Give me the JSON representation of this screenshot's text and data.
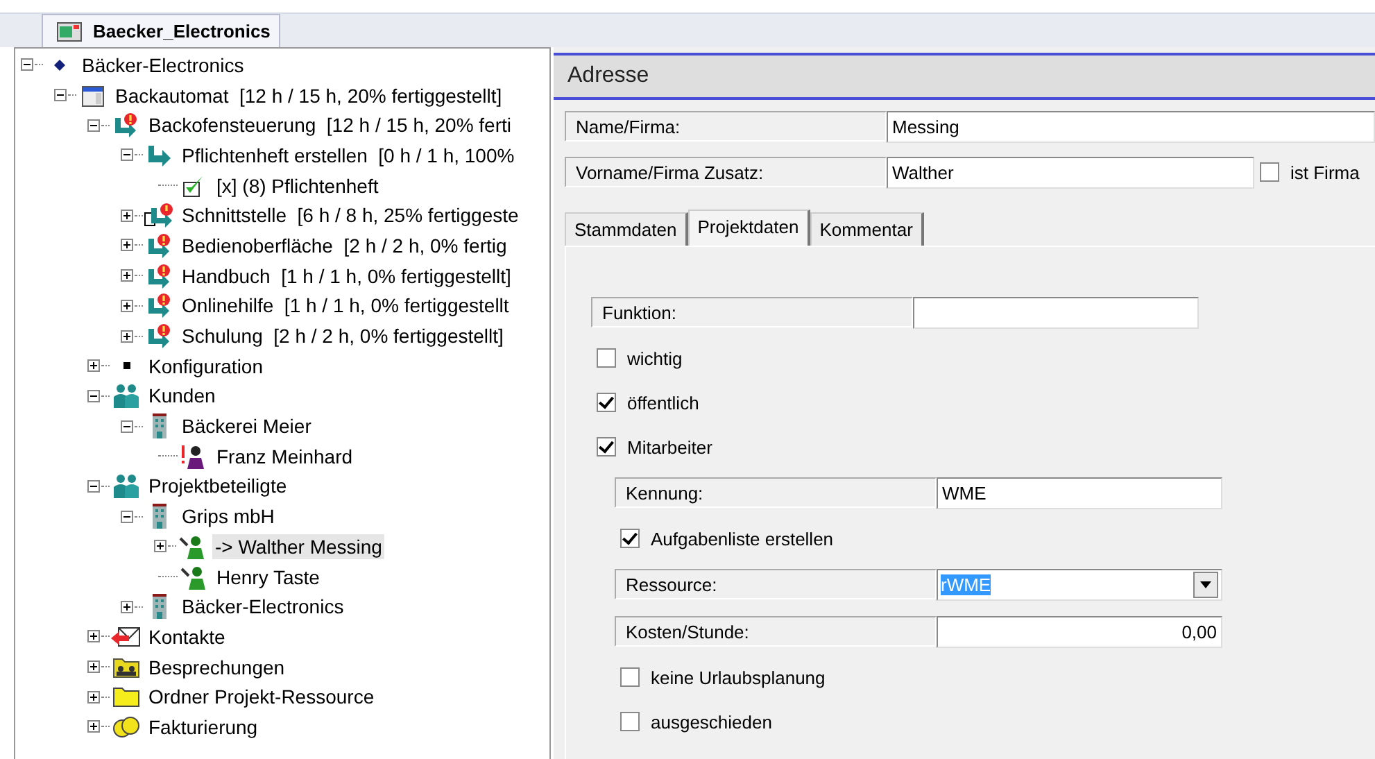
{
  "document_tab": {
    "label": "Baecker_Electronics",
    "selected": true
  },
  "tree": [
    {
      "label": "Bäcker-Electronics",
      "kind": "diamond",
      "expandable": true,
      "expanded": true,
      "selected": false,
      "children": [
        {
          "label": "Backautomat  [12 h / 15 h, 20% fertiggestellt]",
          "kind": "window",
          "expandable": true,
          "expanded": true,
          "selected": false,
          "children": [
            {
              "label": "Backofensteuerung  [12 h / 15 h, 20% ferti",
              "kind": "task-alert",
              "expandable": true,
              "expanded": true,
              "selected": false,
              "children": [
                {
                  "label": "Pflichtenheft erstellen  [0 h / 1 h, 100%",
                  "kind": "task",
                  "expandable": true,
                  "expanded": true,
                  "selected": false,
                  "children": [
                    {
                      "label": "[x] (8) Pflichtenheft",
                      "kind": "done",
                      "expandable": false,
                      "selected": false
                    }
                  ]
                },
                {
                  "label": "Schnittstelle  [6 h / 8 h, 25% fertiggeste",
                  "kind": "doc-task-alert",
                  "expandable": true,
                  "expanded": false,
                  "selected": false
                },
                {
                  "label": "Bedienoberfläche  [2 h / 2 h, 0% fertig",
                  "kind": "task-alert",
                  "expandable": true,
                  "expanded": false,
                  "selected": false
                },
                {
                  "label": "Handbuch  [1 h / 1 h, 0% fertiggestellt]",
                  "kind": "task-alert",
                  "expandable": true,
                  "expanded": false,
                  "selected": false
                },
                {
                  "label": "Onlinehilfe  [1 h / 1 h, 0% fertiggestellt",
                  "kind": "task-alert",
                  "expandable": true,
                  "expanded": false,
                  "selected": false
                },
                {
                  "label": "Schulung  [2 h / 2 h, 0% fertiggestellt]",
                  "kind": "task-alert",
                  "expandable": true,
                  "expanded": false,
                  "selected": false
                }
              ]
            },
            {
              "label": "Konfiguration",
              "kind": "dot",
              "expandable": true,
              "expanded": false,
              "selected": false
            },
            {
              "label": "Kunden",
              "kind": "people",
              "expandable": true,
              "expanded": true,
              "selected": false,
              "children": [
                {
                  "label": "Bäckerei Meier",
                  "kind": "building",
                  "expandable": true,
                  "expanded": true,
                  "selected": false,
                  "children": [
                    {
                      "label": "Franz Meinhard",
                      "kind": "person-alert",
                      "expandable": false,
                      "selected": false
                    }
                  ]
                }
              ]
            },
            {
              "label": "Projektbeteiligte",
              "kind": "people",
              "expandable": true,
              "expanded": true,
              "selected": false,
              "children": [
                {
                  "label": "Grips mbH",
                  "kind": "building",
                  "expandable": true,
                  "expanded": true,
                  "selected": false,
                  "children": [
                    {
                      "label": "-> Walther Messing",
                      "kind": "worker",
                      "expandable": true,
                      "expanded": false,
                      "selected": true
                    },
                    {
                      "label": "Henry Taste",
                      "kind": "worker",
                      "expandable": false,
                      "selected": false
                    }
                  ]
                },
                {
                  "label": "Bäcker-Electronics",
                  "kind": "building",
                  "expandable": true,
                  "expanded": false,
                  "selected": false
                }
              ]
            },
            {
              "label": "Kontakte",
              "kind": "envelope",
              "expandable": true,
              "expanded": false,
              "selected": false
            },
            {
              "label": "Besprechungen",
              "kind": "meeting-folder",
              "expandable": true,
              "expanded": false,
              "selected": false
            },
            {
              "label": "Ordner Projekt-Ressource",
              "kind": "folder",
              "expandable": true,
              "expanded": false,
              "selected": false
            },
            {
              "label": "Fakturierung",
              "kind": "coins",
              "expandable": true,
              "expanded": false,
              "selected": false
            }
          ]
        }
      ]
    }
  ],
  "address_panel": {
    "title": "Adresse",
    "name_field": {
      "label": "Name/Firma:",
      "value": "Messing"
    },
    "first_name_field": {
      "label": "Vorname/Firma Zusatz:",
      "value": "Walther"
    },
    "is_company": {
      "label": "ist Firma",
      "checked": false
    },
    "tabs": [
      {
        "label": "Stammdaten",
        "selected": false
      },
      {
        "label": "Projektdaten",
        "selected": true
      },
      {
        "label": "Kommentar",
        "selected": false
      }
    ],
    "rows": [
      {
        "kind": "field",
        "label": "Funktion:"
      },
      {
        "kind": "check",
        "label": "wichtig",
        "checked": false
      },
      {
        "kind": "check",
        "label": "öffentlich",
        "checked": true
      },
      {
        "kind": "check",
        "label": "Mitarbeiter",
        "checked": true,
        "children": [
          {
            "kind": "field",
            "label": "Kennung:",
            "value": "WME"
          },
          {
            "kind": "check",
            "label": "Aufgabenliste erstellen",
            "checked": true
          },
          {
            "kind": "select",
            "label": "Ressource:",
            "value": "rWME"
          },
          {
            "kind": "number",
            "label": "Kosten/Stunde:",
            "value": "0,00"
          },
          {
            "kind": "check",
            "label": "keine Urlaubsplanung",
            "checked": false
          },
          {
            "kind": "check",
            "label": "ausgeschieden",
            "checked": false
          }
        ]
      }
    ]
  }
}
